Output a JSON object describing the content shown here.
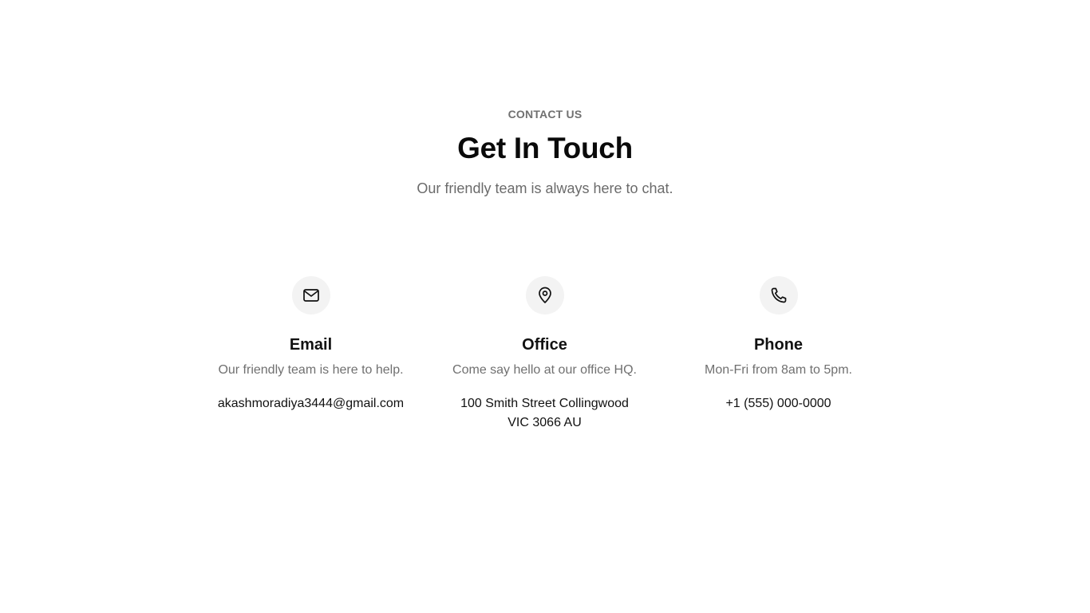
{
  "header": {
    "eyebrow": "CONTACT US",
    "title": "Get In Touch",
    "subtitle": "Our friendly team is always here to chat."
  },
  "cards": [
    {
      "icon": "mail-icon",
      "title": "Email",
      "description": "Our friendly team is here to help.",
      "value": "akashmoradiya3444@gmail.com"
    },
    {
      "icon": "map-pin-icon",
      "title": "Office",
      "description": "Come say hello at our office HQ.",
      "value": "100 Smith Street Collingwood\nVIC 3066 AU"
    },
    {
      "icon": "phone-icon",
      "title": "Phone",
      "description": "Mon-Fri from 8am to 5pm.",
      "value": "+1 (555) 000-0000"
    }
  ],
  "colors": {
    "background": "#ffffff",
    "heading": "#0a0a0a",
    "muted": "#707070",
    "icon_bg": "#f3f3f3"
  }
}
